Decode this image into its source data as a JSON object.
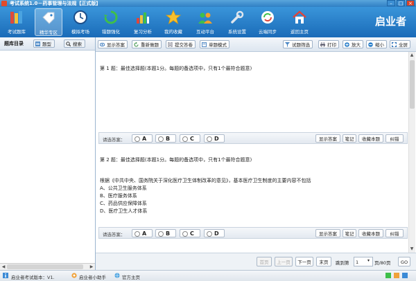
{
  "window": {
    "title": "考试系统1.0－药事管理与法规【正式版】"
  },
  "toolbar": {
    "items": [
      {
        "label": "考试题库"
      },
      {
        "label": "精华专区"
      },
      {
        "label": "模拟考场"
      },
      {
        "label": "错题强化"
      },
      {
        "label": "复习分析"
      },
      {
        "label": "我的收藏"
      },
      {
        "label": "互动平台"
      },
      {
        "label": "系统设置"
      },
      {
        "label": "云端同步"
      },
      {
        "label": "返回主页"
      }
    ],
    "brand": "启业者"
  },
  "left": {
    "title": "题库目录",
    "btn_type": "题型",
    "btn_search": "搜索"
  },
  "right_toolbar": {
    "show_answer": "显示答案",
    "redo": "重新做题",
    "submit": "提交答卷",
    "single_mode": "单题模式",
    "filter": "试题筛选",
    "print": "打印",
    "zoom_in": "放大",
    "zoom_out": "缩小",
    "fullscreen": "全屏"
  },
  "questions": [
    {
      "header": "第 1 题：最佳选择题(本题1分。每题的备选项中，只有1个最符合题意)",
      "body": [],
      "select_label": "请选答案：",
      "options": [
        "A",
        "B",
        "C",
        "D"
      ],
      "actions": [
        "显示答案",
        "笔记",
        "收藏本题",
        "纠错"
      ]
    },
    {
      "header": "第 2 题：最佳选择题(本题1分。每题的备选项中，只有1个最符合题意)",
      "body": [
        "根据《中共中央、国务院关于深化医疗卫生体制改革的意见》，基本医疗卫生制度的主要内容不包括",
        "A、公共卫生服务体系",
        "B、医疗服务体系",
        "C、药品供应保障体系",
        "D、医疗卫生人才体系"
      ],
      "select_label": "请选答案：",
      "options": [
        "A",
        "B",
        "C",
        "D"
      ],
      "actions": [
        "显示答案",
        "笔记",
        "收藏本题",
        "纠错"
      ]
    }
  ],
  "pager": {
    "first": "首页",
    "prev": "上一页",
    "next": "下一页",
    "last": "末页",
    "jump_label": "跳到第",
    "page_value": "1",
    "total": "页/80页",
    "go": "GO"
  },
  "status": {
    "version": "启业者考试版本：V1.",
    "helper": "启业者小助手",
    "home": "官方主页"
  },
  "colors": {
    "toolbar": "#2a7fca",
    "accent": "#1a6bb8"
  }
}
